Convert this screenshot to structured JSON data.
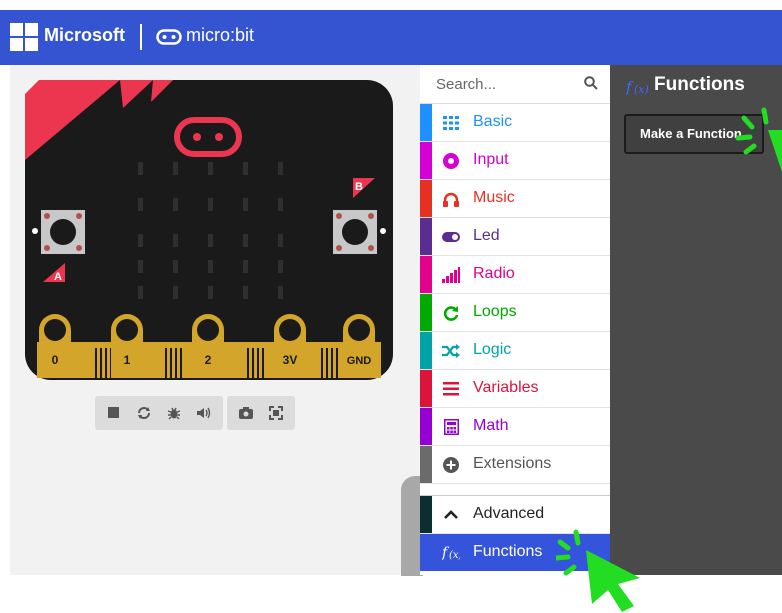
{
  "header": {
    "brand": "Microsoft",
    "product": "micro:bit"
  },
  "simulator": {
    "pins": [
      "0",
      "1",
      "2",
      "3V",
      "GND"
    ],
    "button_a": "A",
    "button_b": "B",
    "tools": [
      "stop-icon",
      "restart-icon",
      "debug-icon",
      "sound-icon",
      "screenshot-icon",
      "fullscreen-icon"
    ]
  },
  "toolbox": {
    "search_placeholder": "Search...",
    "categories": [
      {
        "label": "Basic",
        "color": "#1e90ff",
        "icon": "grid-icon"
      },
      {
        "label": "Input",
        "color": "#d400d4",
        "icon": "circle-dot-icon"
      },
      {
        "label": "Music",
        "color": "#e63022",
        "icon": "headphones-icon"
      },
      {
        "label": "Led",
        "color": "#5c2d91",
        "icon": "toggle-icon"
      },
      {
        "label": "Radio",
        "color": "#e3008c",
        "icon": "signal-bars-icon"
      },
      {
        "label": "Loops",
        "color": "#00aa00",
        "icon": "refresh-icon"
      },
      {
        "label": "Logic",
        "color": "#00a4a6",
        "icon": "shuffle-icon"
      },
      {
        "label": "Variables",
        "color": "#dc143c",
        "icon": "list-icon"
      },
      {
        "label": "Math",
        "color": "#9400d3",
        "icon": "calculator-icon"
      },
      {
        "label": "Extensions",
        "color": "#6b6b6b",
        "icon": "plus-circle-icon"
      }
    ],
    "advanced": {
      "label": "Advanced",
      "color": "#0b2e2e"
    },
    "functions": {
      "label": "Functions",
      "color": "#3455db"
    }
  },
  "flyout": {
    "title": "Functions",
    "make_function": "Make a Function..."
  },
  "colors": {
    "header": "#3454d1",
    "board": "#1a1a1a",
    "board_accent": "#ec3650",
    "pin_gold": "#d4a52b",
    "highlight": "#22dd22"
  }
}
